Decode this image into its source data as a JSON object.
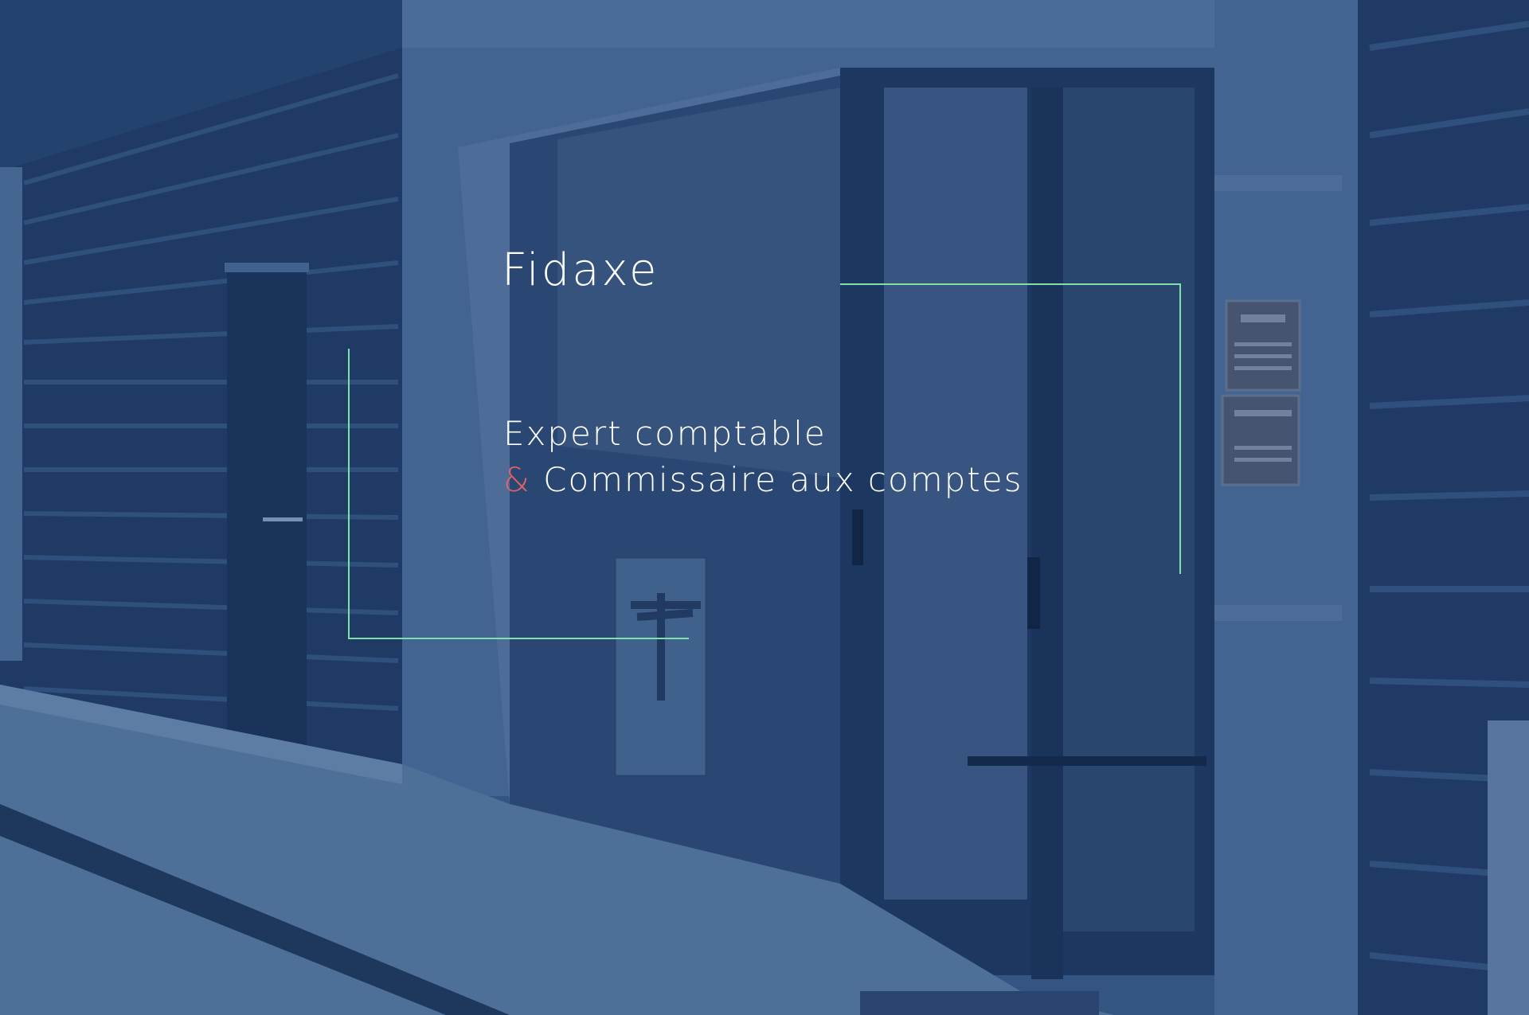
{
  "brand": {
    "name": "Fidaxe"
  },
  "tagline": {
    "line1": "Expert comptable",
    "ampersand": "&",
    "line2": "Commissaire aux comptes"
  },
  "colors": {
    "overlay": "#2b4a78",
    "accent_line": "#7fe0a8",
    "ampersand": "#e36366",
    "text": "#ffffff"
  },
  "icons": {
    "logo_mark": "f-letter-logo"
  }
}
